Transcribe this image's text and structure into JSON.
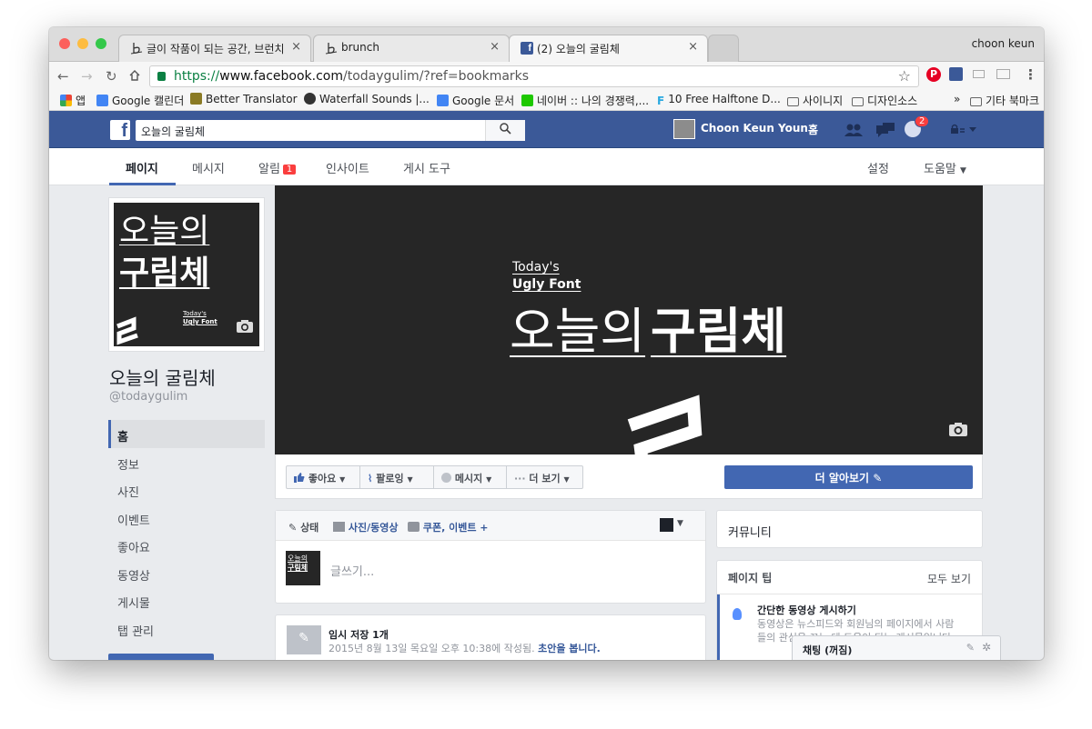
{
  "browser": {
    "tabs": [
      {
        "title": "글이 작품이 되는 공간, 브런치"
      },
      {
        "title": "brunch"
      },
      {
        "title": "(2) 오늘의 굴림체"
      }
    ],
    "close_glyph": "×",
    "user": "choon keun",
    "url_scheme": "https://",
    "url_host": "www.facebook.com",
    "url_path": "/todaygulim/?ref=bookmarks",
    "bookmarks": [
      "앱",
      "Google 캘린더",
      "Better Translator",
      "Waterfall Sounds |...",
      "Google 문서",
      "네이버 :: 나의 경쟁력,...",
      "10 Free Halftone D...",
      "사이니지",
      "디자인소스"
    ],
    "bookmarks_more": "»",
    "other_bookmarks": "기타 북마크"
  },
  "fb": {
    "logo": "f",
    "search_value": "오늘의 굴림체",
    "search_icon": "magnifier-icon",
    "user_name": "Choon Keun Youn",
    "home": "홈",
    "notif_count": "2",
    "brand_color": "#3b5998"
  },
  "page_nav": {
    "items": [
      "페이지",
      "메시지",
      "알림",
      "인사이트",
      "게시 도구"
    ],
    "notif_badge": "1",
    "settings": "설정",
    "help": "도움말"
  },
  "profile": {
    "logo_line1": "오늘의",
    "logo_line2": "구림체",
    "logo_en1": "Today's",
    "logo_en2": "Ugly Font",
    "name": "오늘의 굴림체",
    "handle": "@todaygulim",
    "side_menu": [
      "홈",
      "정보",
      "사진",
      "이벤트",
      "좋아요",
      "동영상",
      "게시물",
      "탭 관리"
    ]
  },
  "cover": {
    "en1": "Today's",
    "en2": "Ugly Font",
    "title_light": "오늘의",
    "title_bold": "구림체"
  },
  "actions": {
    "like": "좋아요",
    "follow": "팔로잉",
    "message": "메시지",
    "more": "더 보기",
    "learn_more": "더 알아보기"
  },
  "composer": {
    "tab_status": "상태",
    "tab_photo": "사진/동영상",
    "tab_offer": "쿠폰, 이벤트 +",
    "placeholder": "글쓰기..."
  },
  "draft": {
    "title": "임시 저장 1개",
    "text": "2015년 8월 13일 목요일 오후 10:38에 작성됨.",
    "link": "초안을 봅니다."
  },
  "community": {
    "title": "커뮤니티"
  },
  "tips": {
    "title": "페이지 팁",
    "see_all": "모두 보기",
    "item_title": "간단한 동영상 게시하기",
    "item_text": "동영상은 뉴스피드와 회원님의 페이지에서 사람들의 관심을 끄는 데 도움이 되는 게시물입니다."
  },
  "chat": {
    "label": "채팅 (꺼짐)"
  }
}
